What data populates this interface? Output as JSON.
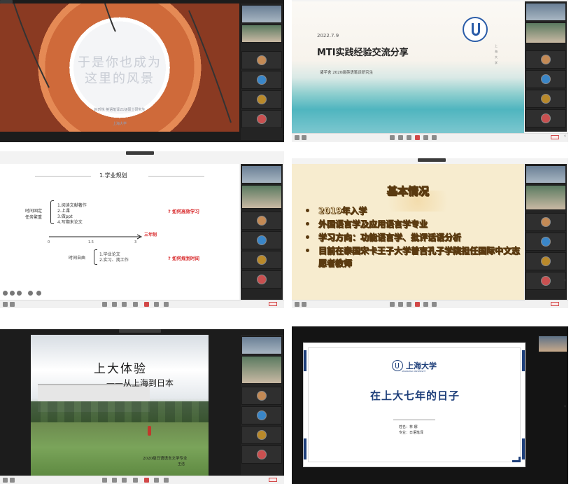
{
  "panels": {
    "p1": {
      "title_line1": "于是你也成为",
      "title_line2": "这里的风景",
      "presenter": "赵昕悦 英语笔译21级硕士研究生",
      "university": "上海大学"
    },
    "p2": {
      "date": "2022.7.9",
      "title": "MTI实践经验交流分享",
      "presenter": "诸芊舍 2020级英语笔译研究生",
      "vertical_text": "上 海 大 学"
    },
    "p3": {
      "heading": "1.学业规划",
      "left_label_1": "时间固定",
      "left_label_2": "任务繁重",
      "tasks": [
        "1.阅读文献著作",
        "2.上课",
        "3.做ppt",
        "4.写期末论文"
      ],
      "q1": "? 如何高效学习",
      "timeline_label": "三年制",
      "ticks": [
        "0",
        "1.5",
        "3"
      ],
      "free_label": "时间自由",
      "free_items": [
        "1.毕业论文",
        "2.实习、找工作"
      ],
      "q2": "? 如何规划时间"
    },
    "p4": {
      "heading": "基本情况",
      "bullets": [
        "2019年入学",
        "外国语言学及应用语言学专业",
        "学习方向：功能语言学、批评话语分析",
        "目前在泰国宋卡王子大学普吉孔子学院担任国际中文志愿者教师"
      ]
    },
    "p5": {
      "title": "上大体验",
      "subtitle": "——从上海到日本",
      "caption_line1": "2020级日语语言文学专业",
      "caption_line2": "王洁"
    },
    "p6": {
      "university": "上海大学",
      "university_en": "SHANGHAI UNIVERSITY",
      "title": "在上大七年的日子",
      "name_line": "姓名：林 娜",
      "major_line": "专业：日语笔译"
    }
  },
  "colors": {
    "accent_red": "#d8282a",
    "dark_navy": "#1e3f7a",
    "orange_title": "#c4621b",
    "teal_title": "#2b2b5a"
  }
}
